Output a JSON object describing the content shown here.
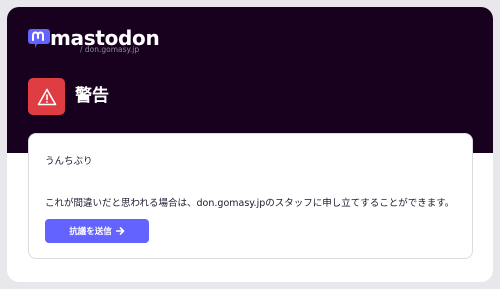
{
  "brand": {
    "wordmark": "mastodon",
    "domain": "/ don.gomasy.jp"
  },
  "alert": {
    "icon": "warning-icon",
    "title": "警告"
  },
  "content": {
    "message": "うんちぶり",
    "appeal_text": "これが間違いだと思われる場合は、don.gomasy.jpのスタッフに申し立てすることができます。",
    "appeal_button": "抗議を送信",
    "appeal_button_icon": "arrow-right-icon"
  },
  "colors": {
    "page_bg": "#e8e7ec",
    "hero_bg": "#18001f",
    "alert_red": "#e03d43",
    "accent": "#6364ff",
    "logo_mark": "#6364ff"
  }
}
